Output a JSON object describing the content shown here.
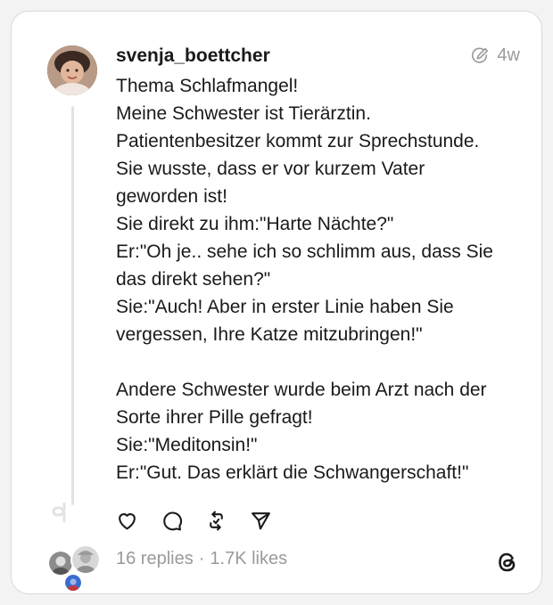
{
  "post": {
    "username": "svenja_boettcher",
    "time": "4w",
    "lines": [
      "Thema Schlafmangel!",
      "Meine Schwester ist Tierärztin.",
      "Patientenbesitzer kommt zur Sprechstunde.",
      "Sie wusste, dass er vor kurzem Vater",
      "geworden ist!",
      "Sie direkt zu ihm:\"Harte Nächte?\"",
      "Er:\"Oh je.. sehe ich so schlimm aus, dass Sie",
      "das direkt sehen?\"",
      "Sie:\"Auch! Aber in erster Linie haben Sie",
      "vergessen, Ihre Katze mitzubringen!\"",
      "",
      "Andere Schwester wurde beim Arzt nach der",
      "Sorte ihrer Pille gefragt!",
      "Sie:\"Meditonsin!\"",
      "Er:\"Gut. Das erklärt die Schwangerschaft!\""
    ]
  },
  "footer": {
    "replies": "16 replies",
    "separator": "·",
    "likes": "1.7K likes"
  },
  "icons": {
    "edited": "pen-circle-icon",
    "like": "heart-icon",
    "reply": "comment-icon",
    "repost": "repost-icon",
    "share": "send-icon",
    "logo": "threads-logo-icon"
  },
  "colors": {
    "text": "#1a1a1a",
    "muted": "#9a9a9a",
    "border": "#d9d9d9"
  }
}
